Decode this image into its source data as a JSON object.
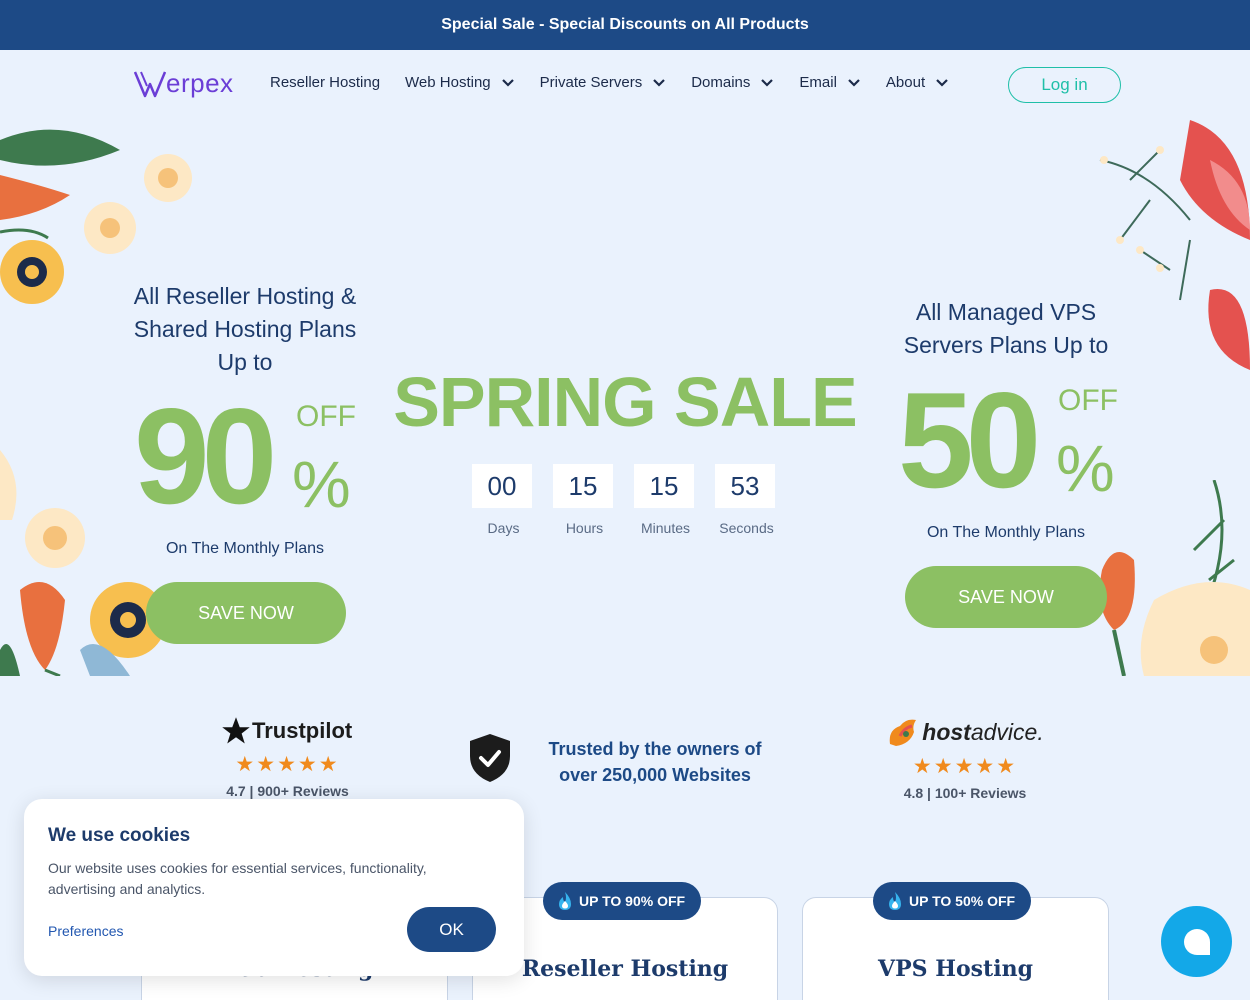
{
  "topbar": {
    "text": "Special Sale - Special Discounts on All Products"
  },
  "logo": {
    "text": "erpex"
  },
  "nav": {
    "items": [
      {
        "label": "Reseller Hosting",
        "dropdown": false
      },
      {
        "label": "Web Hosting",
        "dropdown": true
      },
      {
        "label": "Private Servers",
        "dropdown": true
      },
      {
        "label": "Domains",
        "dropdown": true
      },
      {
        "label": "Email",
        "dropdown": true
      },
      {
        "label": "About",
        "dropdown": true
      }
    ],
    "login_label": "Log in"
  },
  "hero": {
    "left": {
      "heading": "All Reseller Hosting & Shared Hosting Plans Up to",
      "number": "90",
      "off": "OFF",
      "pct": "%",
      "sub": "On The Monthly Plans",
      "button": "SAVE NOW"
    },
    "center": {
      "title": "SPRING SALE",
      "countdown": [
        {
          "value": "00",
          "label": "Days"
        },
        {
          "value": "15",
          "label": "Hours"
        },
        {
          "value": "15",
          "label": "Minutes"
        },
        {
          "value": "53",
          "label": "Seconds"
        }
      ]
    },
    "right": {
      "heading": "All Managed VPS Servers Plans Up to",
      "number": "50",
      "off": "OFF",
      "pct": "%",
      "sub": "On The Monthly Plans",
      "button": "SAVE NOW"
    }
  },
  "trust": {
    "trustpilot": {
      "name": "Trustpilot",
      "stars": "★★★★★",
      "reviews": "4.7 | 900+ Reviews"
    },
    "owners": {
      "text": "Trusted by the owners of over 250,000 Websites"
    },
    "hostadvice": {
      "name_bold": "host",
      "name_rest": "advice.",
      "stars": "★★★★★",
      "reviews": "4.8 | 100+ Reviews"
    }
  },
  "cards": [
    {
      "title": "Web Hosting",
      "badge": ""
    },
    {
      "title": "Reseller Hosting",
      "badge": "UP TO 90% OFF"
    },
    {
      "title": "VPS Hosting",
      "badge": "UP TO 50% OFF"
    }
  ],
  "cookie": {
    "title": "We use cookies",
    "text": "Our website uses cookies for essential services, functionality, advertising and analytics.",
    "preferences": "Preferences",
    "ok": "OK"
  },
  "colors": {
    "brand_blue": "#1d4a86",
    "green": "#8cc063",
    "teal": "#1fbfa8",
    "purple": "#6b3ed6",
    "chat": "#13a8e8",
    "star": "#f08a1d"
  }
}
